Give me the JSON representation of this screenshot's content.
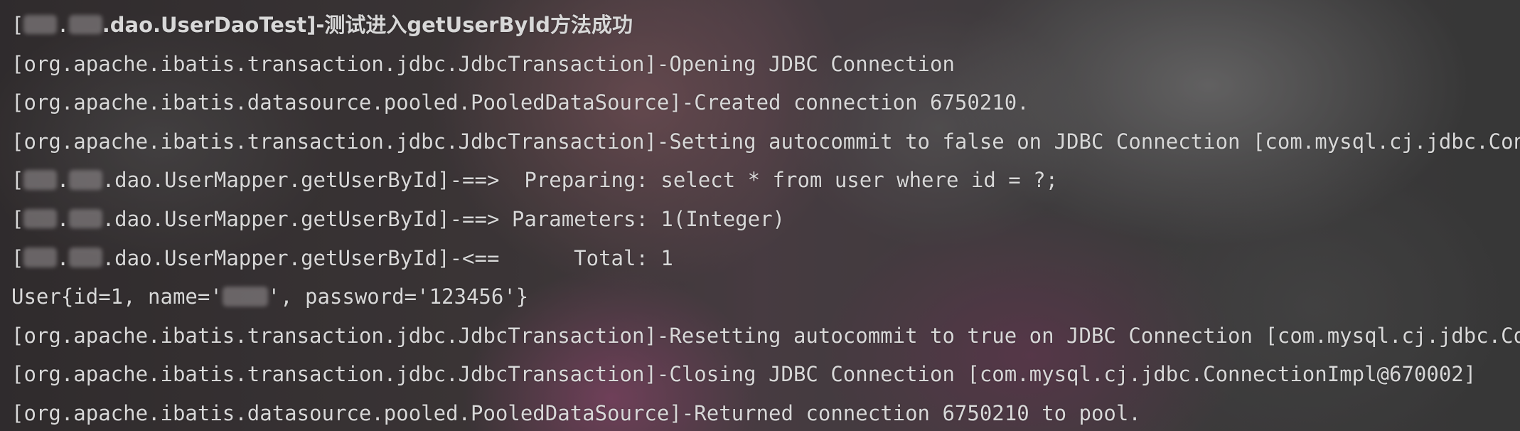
{
  "console": {
    "lines": [
      {
        "open": "[",
        "redaction_1": "",
        "dot_1": ".",
        "redaction_2": "",
        "rest": ".dao.UserDaoTest]-测试进入getUserById方法成功"
      },
      {
        "text": "[org.apache.ibatis.transaction.jdbc.JdbcTransaction]-Opening JDBC Connection"
      },
      {
        "text": "[org.apache.ibatis.datasource.pooled.PooledDataSource]-Created connection 6750210."
      },
      {
        "text": "[org.apache.ibatis.transaction.jdbc.JdbcTransaction]-Setting autocommit to false on JDBC Connection [com.mysql.cj.jdbc.Con"
      },
      {
        "open": "[",
        "redaction_1": "",
        "dot_1": ".",
        "redaction_2": "",
        "rest": ".dao.UserMapper.getUserById]-==>  Preparing: select * from user where id = ?;"
      },
      {
        "open": "[",
        "redaction_1": "",
        "dot_1": ".",
        "redaction_2": "",
        "rest": ".dao.UserMapper.getUserById]-==> Parameters: 1(Integer)"
      },
      {
        "open": "[",
        "redaction_1": "",
        "dot_1": ".",
        "redaction_2": "",
        "rest": ".dao.UserMapper.getUserById]-<==      Total: 1"
      },
      {
        "prefix": "User{id=1, name='",
        "redaction": "",
        "suffix": "', password='123456'}"
      },
      {
        "text": "[org.apache.ibatis.transaction.jdbc.JdbcTransaction]-Resetting autocommit to true on JDBC Connection [com.mysql.cj.jdbc.Co"
      },
      {
        "text": "[org.apache.ibatis.transaction.jdbc.JdbcTransaction]-Closing JDBC Connection [com.mysql.cj.jdbc.ConnectionImpl@670002]"
      },
      {
        "text": "[org.apache.ibatis.datasource.pooled.PooledDataSource]-Returned connection 6750210 to pool."
      }
    ]
  },
  "colors": {
    "text": "#d8d8d8"
  }
}
